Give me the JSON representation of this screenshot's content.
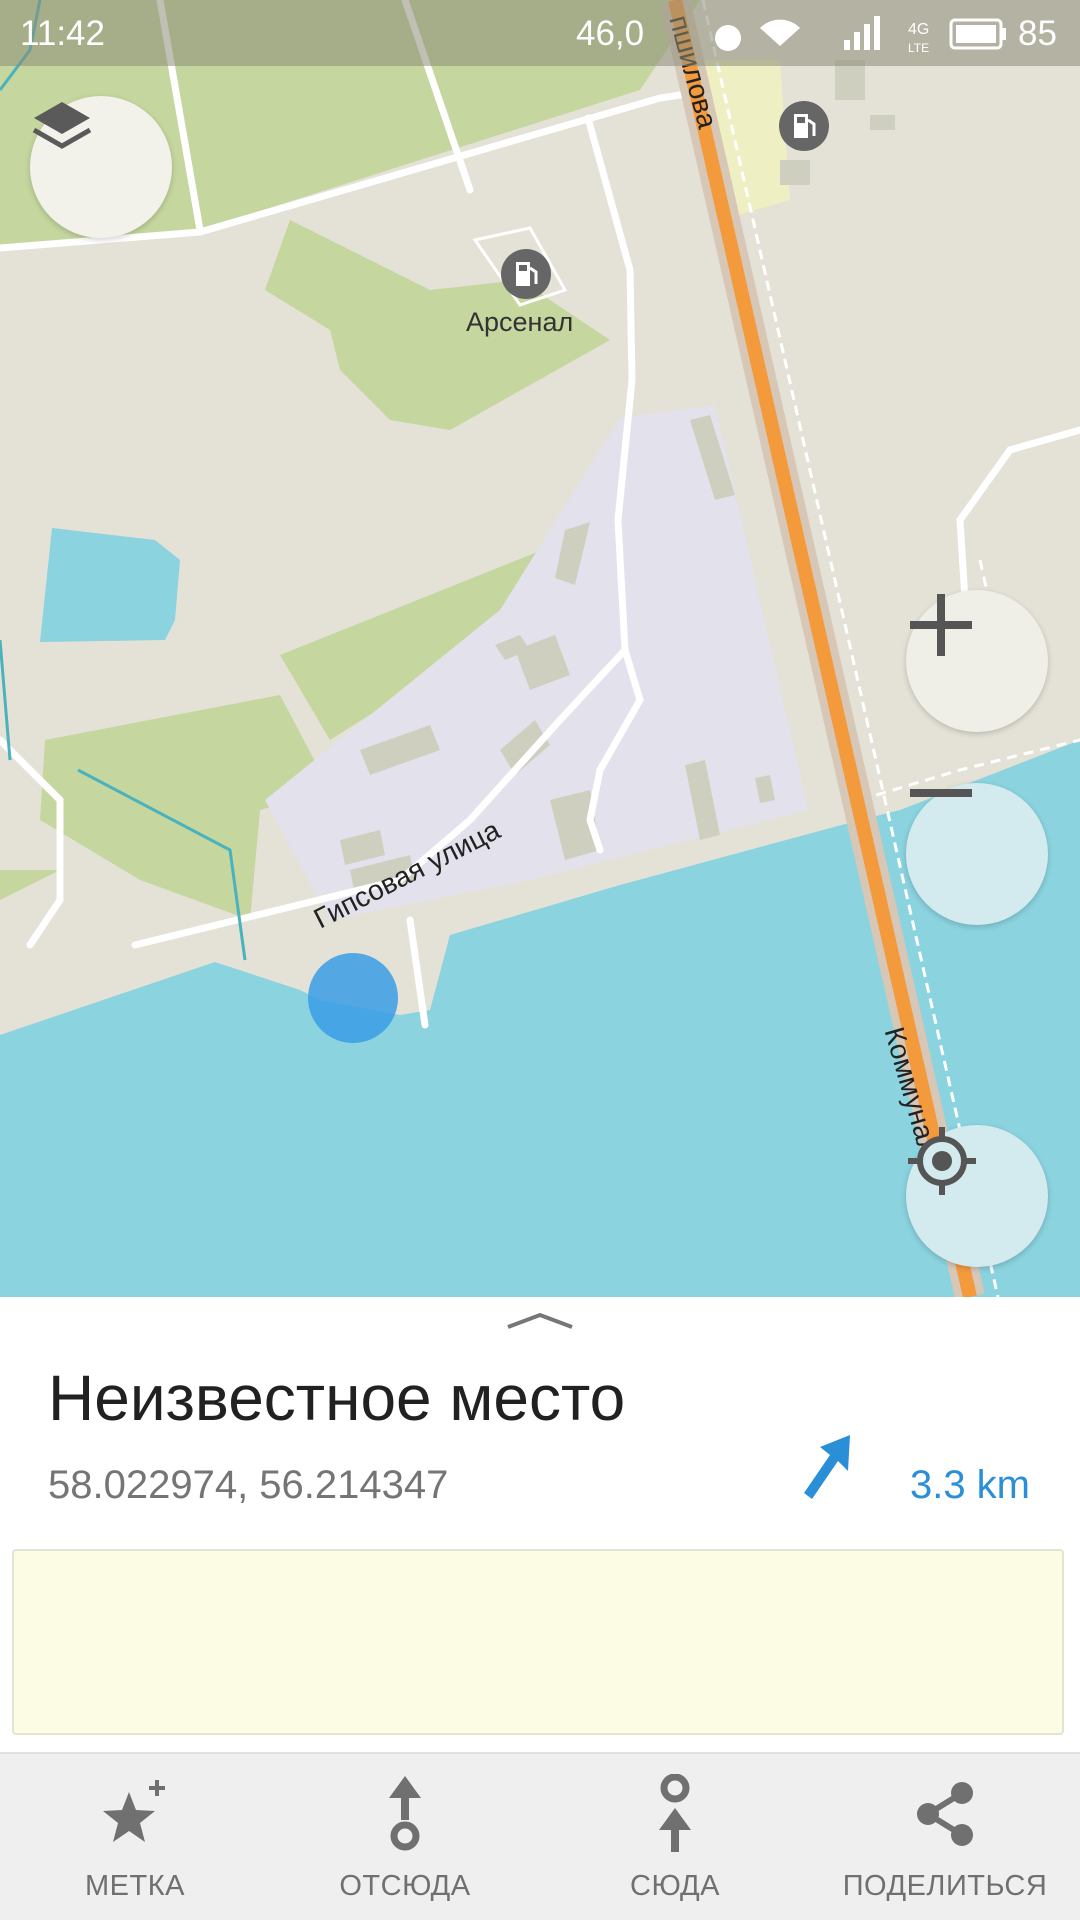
{
  "status_bar": {
    "time": "11:42",
    "speed": "46,0",
    "battery": "85",
    "network": "4G LTE"
  },
  "map": {
    "poi_label": "Арсенал",
    "street_gipsovaya": "Гипсовая улица",
    "street_top": "пшилова",
    "street_bottom": "Коммунальный"
  },
  "place": {
    "title": "Неизвестное место",
    "coordinates": "58.022974, 56.214347",
    "distance": "3.3 km"
  },
  "actions": [
    {
      "label": "МЕТКА",
      "icon": "star-plus-icon"
    },
    {
      "label": "ОТСЮДА",
      "icon": "route-from-icon"
    },
    {
      "label": "СЮДА",
      "icon": "route-to-icon"
    },
    {
      "label": "ПОДЕЛИТЬСЯ",
      "icon": "share-icon"
    }
  ],
  "colors": {
    "water": "#8ad3df",
    "land": "#e4e1d6",
    "park": "#c5d69e",
    "industrial": "#e3e2ec",
    "main_road": "#f39a3c",
    "accent": "#2b8fd8",
    "note_background": "#fcfce4"
  }
}
